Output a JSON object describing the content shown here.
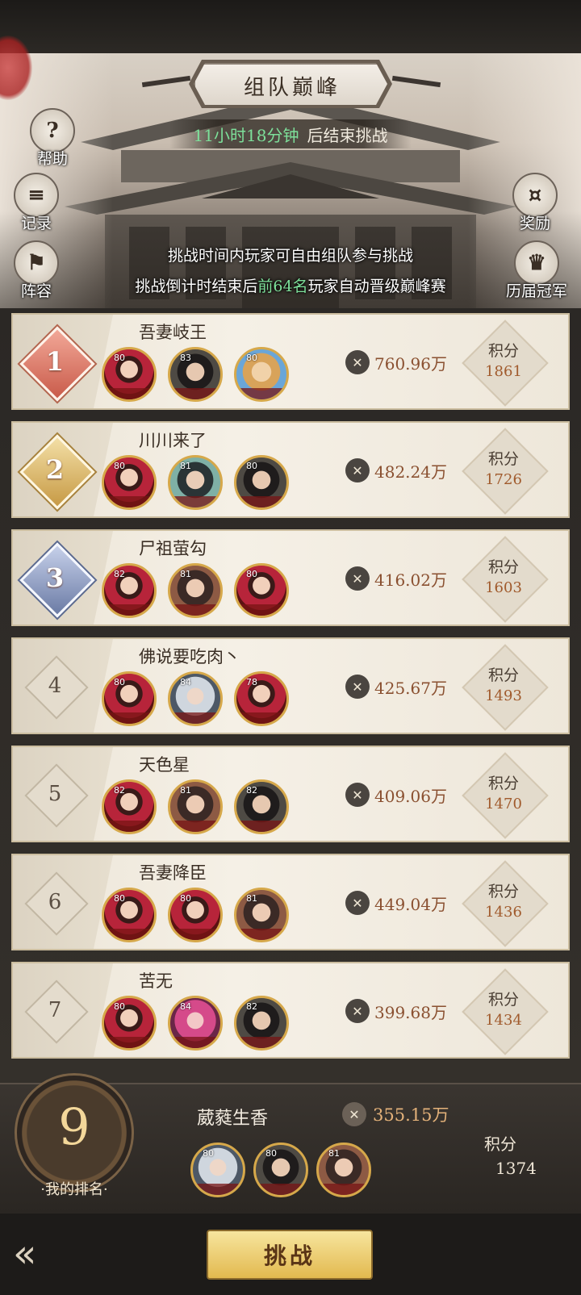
{
  "title": "组队巅峰",
  "timer": {
    "value": "11小时18分钟",
    "suffix": "后结束挑战"
  },
  "side_buttons": {
    "help": "帮助",
    "records": "记录",
    "lineup": "阵容",
    "rewards": "奖励",
    "champions": "历届冠军"
  },
  "info": {
    "line1": "挑战时间内玩家可自由组队参与挑战",
    "line2_pre": "挑战倒计时结束后",
    "line2_hl": "前64名",
    "line2_post": "玩家自动晋级巅峰赛"
  },
  "score_label": "积分",
  "rows": [
    {
      "rank": "1",
      "name": "吾妻岐王",
      "power": "760.96万",
      "score": "1861",
      "heroes": [
        {
          "level": "80"
        },
        {
          "level": "83"
        },
        {
          "level": "80"
        }
      ]
    },
    {
      "rank": "2",
      "name": "川川来了",
      "power": "482.24万",
      "score": "1726",
      "heroes": [
        {
          "level": "80"
        },
        {
          "level": "81"
        },
        {
          "level": "80"
        }
      ]
    },
    {
      "rank": "3",
      "name": "尸祖萤勾",
      "power": "416.02万",
      "score": "1603",
      "heroes": [
        {
          "level": "82"
        },
        {
          "level": "81"
        },
        {
          "level": "80"
        }
      ]
    },
    {
      "rank": "4",
      "name": "佛说要吃肉丶",
      "power": "425.67万",
      "score": "1493",
      "heroes": [
        {
          "level": "80"
        },
        {
          "level": "84"
        },
        {
          "level": "78"
        }
      ]
    },
    {
      "rank": "5",
      "name": "天色星",
      "power": "409.06万",
      "score": "1470",
      "heroes": [
        {
          "level": "82"
        },
        {
          "level": "81"
        },
        {
          "level": "82"
        }
      ]
    },
    {
      "rank": "6",
      "name": "吾妻降臣",
      "power": "449.04万",
      "score": "1436",
      "heroes": [
        {
          "level": "80"
        },
        {
          "level": "80"
        },
        {
          "level": "81"
        }
      ]
    },
    {
      "rank": "7",
      "name": "苦无",
      "power": "399.68万",
      "score": "1434",
      "heroes": [
        {
          "level": "80"
        },
        {
          "level": "84"
        },
        {
          "level": "82"
        }
      ]
    }
  ],
  "my_rank": {
    "rank": "9",
    "label": "·我的排名·",
    "name": "葳蕤生香",
    "power": "355.15万",
    "score_label": "积分",
    "score": "1374",
    "heroes": [
      {
        "level": "80"
      },
      {
        "level": "80"
      },
      {
        "level": "81"
      }
    ]
  },
  "challenge_button": "挑战",
  "back_icon": "back-arrow-icon",
  "power_icon": "crossed-swords-icon"
}
